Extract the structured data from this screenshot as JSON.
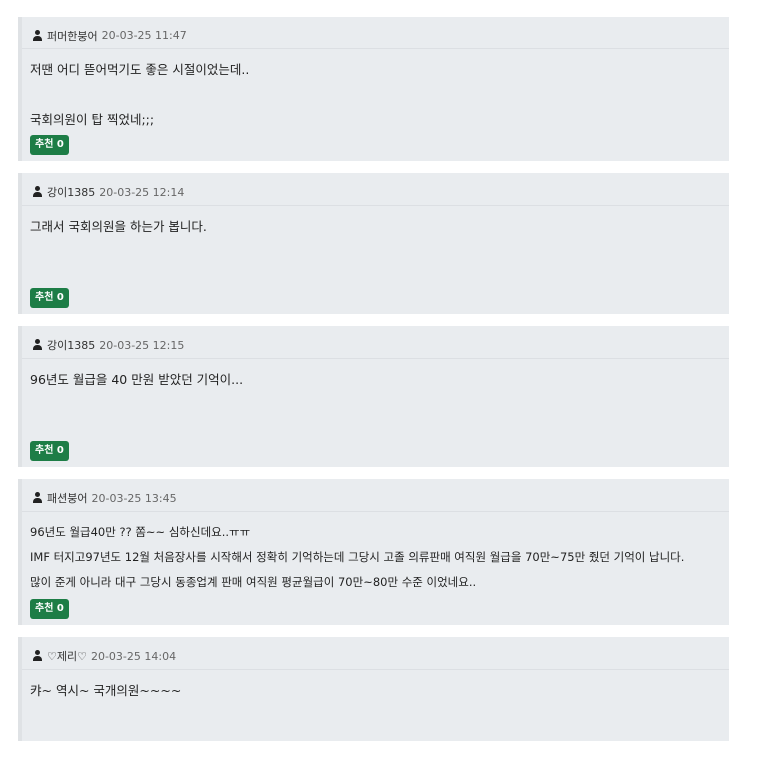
{
  "rec_label": "추천 0",
  "comments": [
    {
      "author": "퍼머한붕어",
      "time": "20-03-25 11:47",
      "lines": [
        "저땐 어디 뜯어먹기도 좋은 시절이었는데..",
        "",
        "국회의원이 탑 찍었네;;;"
      ],
      "has_button": true
    },
    {
      "author": "강이1385",
      "time": "20-03-25 12:14",
      "lines": [
        "그래서 국회의원을 하는가 봅니다."
      ],
      "has_button": true
    },
    {
      "author": "강이1385",
      "time": "20-03-25 12:15",
      "lines": [
        "96년도 월급을 40 만원 받았던 기억이..."
      ],
      "has_button": true
    },
    {
      "author": "패션붕어",
      "time": "20-03-25 13:45",
      "lines": [
        "96년도 월급40만 ?? 쫌~~ 심하신데요..ㅠㅠ",
        "IMF 터지고97년도 12월 처음장사를 시작해서 정확히 기억하는데 그당시 고졸 의류판매 여직원 월급을 70만~75만 줬던 기억이 납니다.",
        "많이 준게 아니라 대구 그당시 동종업계 판매 여직원 평균월급이 70만~80만 수준 이었네요.."
      ],
      "has_button": true
    },
    {
      "author": "♡제리♡",
      "time": "20-03-25 14:04",
      "lines": [
        "캬~ 역시~ 국개의원~~~~"
      ],
      "has_button": false
    }
  ]
}
